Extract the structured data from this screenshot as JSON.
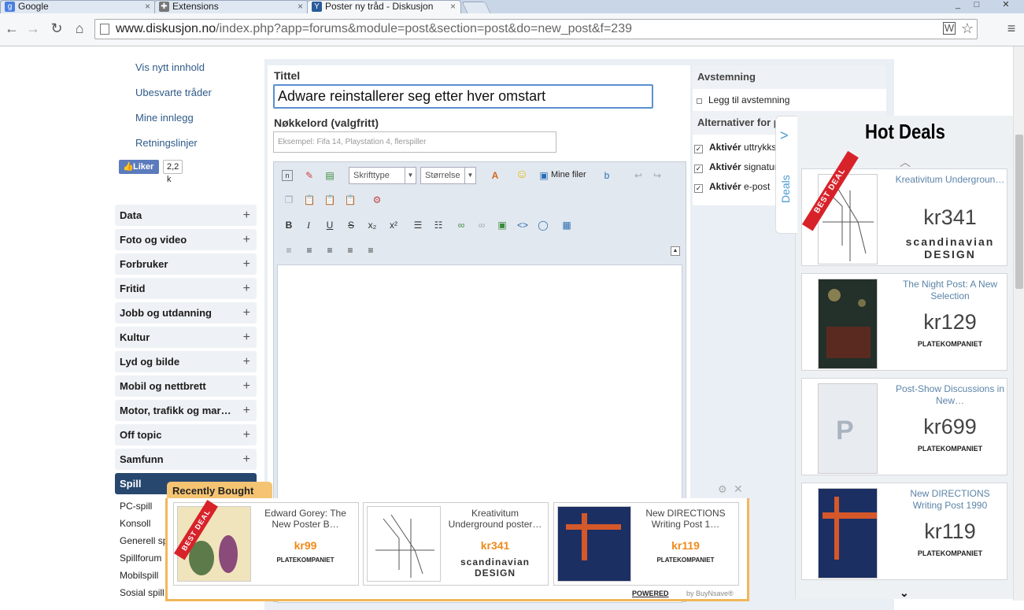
{
  "browser": {
    "tabs": [
      {
        "label": "Google",
        "icon": "google-icon"
      },
      {
        "label": "Extensions",
        "icon": "puzzle-icon"
      },
      {
        "label": "Poster ny tråd - Diskusjon",
        "icon": "diskusjon-icon"
      }
    ],
    "url_domain": "www.diskusjon.no",
    "url_path": "/index.php?app=forums&module=post&section=post&do=new_post&f=239"
  },
  "sidebar": {
    "links": [
      "Vis nytt innhold",
      "Ubesvarte tråder",
      "Mine innlegg",
      "Retningslinjer"
    ],
    "like_label": "Liker",
    "like_count": "2,2 k",
    "categories": [
      "Data",
      "Foto og video",
      "Forbruker",
      "Fritid",
      "Jobb og utdanning",
      "Kultur",
      "Lyd og bilde",
      "Mobil og nettbrett",
      "Motor, trafikk og mar…",
      "Off topic",
      "Samfunn",
      "Spill"
    ],
    "subitems": [
      "PC-spill",
      "Konsoll",
      "Generell sp",
      "Spillforum",
      "Mobilspill",
      "Sosial spill"
    ]
  },
  "form": {
    "title_label": "Tittel",
    "title_value": "Adware reinstallerer seg etter hver omstart",
    "keywords_label": "Nøkkelord (valgfritt)",
    "keywords_placeholder": "Eksempel: Fifa 14, Playstation 4, flerspiller",
    "font_select": "Skrifttype",
    "size_select": "Størrelse",
    "my_files": "Mine filer"
  },
  "poll": {
    "header": "Avstemning",
    "add_poll": "Legg til avstemning",
    "options_header": "Alternativer for post",
    "options": [
      {
        "label": "Aktivér",
        "rest": "uttrykksiko"
      },
      {
        "label": "Aktivér",
        "rest": "signatur?"
      },
      {
        "label": "Aktivér",
        "rest": "e-post"
      }
    ]
  },
  "hot_deals": {
    "tab_label": "Deals",
    "title": "Hot Deals",
    "best_deal": "BEST DEAL",
    "items": [
      {
        "title": "Kreativitum Undergroun…",
        "price": "kr341",
        "vendor": "scandinavian DESIGN"
      },
      {
        "title": "The Night Post: A New Selection",
        "price": "kr129",
        "vendor": "PLATEKOMPANIET"
      },
      {
        "title": "Post-Show Discussions in New…",
        "price": "kr699",
        "vendor": "PLATEKOMPANIET"
      },
      {
        "title": "New DIRECTIONS Writing Post 1990",
        "price": "kr119",
        "vendor": "PLATEKOMPANIET"
      }
    ]
  },
  "recently_bought": {
    "title": "Recently Bought",
    "powered": "POWERED",
    "by": "by BuyNsave®",
    "items": [
      {
        "title": "Edward Gorey: The New Poster B…",
        "price": "kr99",
        "vendor": "PLATEKOMPANIET"
      },
      {
        "title": "Kreativitum Underground poster…",
        "price": "kr341",
        "vendor": "scandinavian DESIGN"
      },
      {
        "title": "New DIRECTIONS Writing Post 1…",
        "price": "kr119",
        "vendor": "PLATEKOMPANIET"
      }
    ]
  },
  "colors": {
    "accent": "#27476e",
    "link": "#2f5a88",
    "price": "#f08a1a",
    "deal_ribbon": "#d8222a"
  }
}
